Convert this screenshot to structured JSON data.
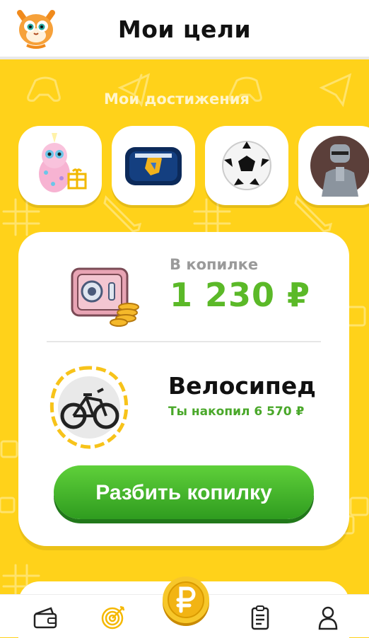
{
  "header": {
    "title": "Мои цели",
    "logo_icon": "cat-mascot-icon"
  },
  "achievements": {
    "title": "Мои достижения",
    "items": [
      {
        "name": "plush-unicorn-toy",
        "icon": "unicorn-toy-icon"
      },
      {
        "name": "transformers-pencil-case",
        "icon": "pencil-case-icon"
      },
      {
        "name": "soccer-ball",
        "icon": "soccer-ball-icon"
      },
      {
        "name": "robocop-figure",
        "icon": "robot-figure-icon"
      }
    ]
  },
  "piggy_bank": {
    "label": "В копилке",
    "amount": "1 230 ₽",
    "icon": "safe-with-coins-icon"
  },
  "goal": {
    "name": "Велосипед",
    "saved_text": "Ты накопил 6 570 ₽",
    "icon": "bicycle-icon"
  },
  "actions": {
    "break_label": "Разбить копилку"
  },
  "nav": {
    "items": [
      {
        "name": "wallet",
        "icon": "wallet-icon",
        "active": false
      },
      {
        "name": "goals",
        "icon": "target-icon",
        "active": true
      },
      {
        "name": "coin",
        "icon": "ruble-coin-icon",
        "active": false
      },
      {
        "name": "tasks",
        "icon": "checklist-icon",
        "active": false
      },
      {
        "name": "profile",
        "icon": "person-icon",
        "active": false
      }
    ]
  },
  "colors": {
    "background": "#ffd21a",
    "accent_green": "#5bb928",
    "button_green": "#3fae24"
  }
}
